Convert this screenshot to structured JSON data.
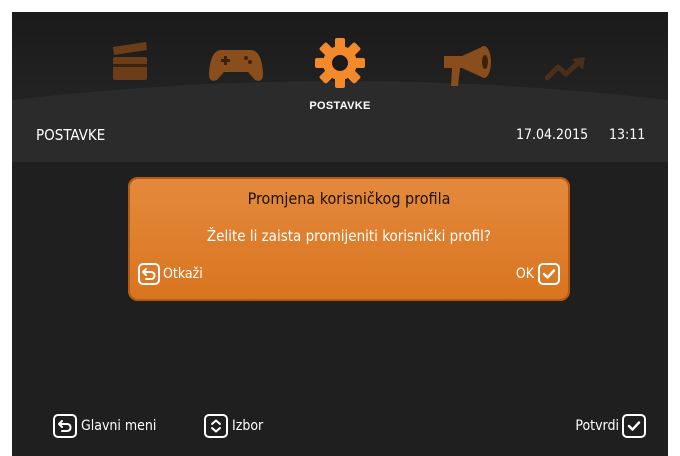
{
  "nav": {
    "icons": [
      "clapperboard-icon",
      "gamepad-icon",
      "gear-icon",
      "megaphone-icon",
      "trending-icon"
    ],
    "active_label": "POSTAVKE"
  },
  "header": {
    "title": "POSTAVKE",
    "date": "17.04.2015",
    "time": "13:11"
  },
  "dialog": {
    "title": "Promjena korisničkog profila",
    "message": "Želite li zaista promijeniti korisnički profil?",
    "cancel_label": "Otkaži",
    "ok_label": "OK"
  },
  "footer": {
    "back_label": "Glavni meni",
    "select_label": "Izbor",
    "confirm_label": "Potvrdi"
  },
  "colors": {
    "accent": "#e0822f",
    "background": "#1f1f1f",
    "inactive_icon": "#8a4d1c"
  }
}
